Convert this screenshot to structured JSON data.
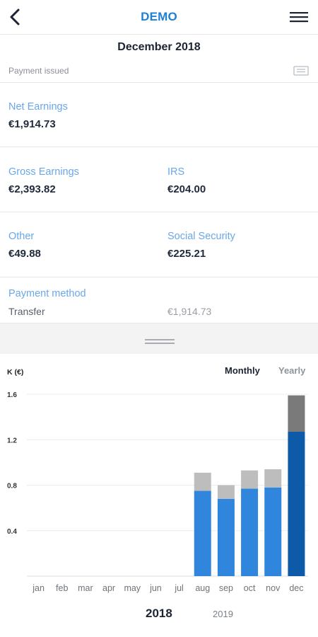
{
  "header": {
    "title": "DEMO"
  },
  "period": {
    "title": "December 2018"
  },
  "status": {
    "text": "Payment issued"
  },
  "net": {
    "label": "Net Earnings",
    "value": "€1,914.73"
  },
  "gross": {
    "label": "Gross Earnings",
    "value": "€2,393.82"
  },
  "irs": {
    "label": "IRS",
    "value": "€204.00"
  },
  "other": {
    "label": "Other",
    "value": "€49.88"
  },
  "social": {
    "label": "Social Security",
    "value": "€225.21"
  },
  "payment": {
    "label": "Payment method",
    "method": "Transfer",
    "amount": "€1,914.73"
  },
  "colors": {
    "accent": "#1d7fd8",
    "label": "#6aa7e8",
    "bar_net": "#2f86dc",
    "bar_net_selected": "#0c5aa8",
    "bar_deduction": "#bdbdbd",
    "bar_deduction_selected": "#7a7a7a"
  },
  "chart_tabs": {
    "monthly": "Monthly",
    "yearly": "Yearly",
    "active": "Monthly"
  },
  "years": {
    "current": "2018",
    "next": "2019"
  },
  "chart_data": {
    "type": "bar",
    "stacked": true,
    "y_unit_label": "K (€)",
    "yticks": [
      0.4,
      0.8,
      1.2,
      1.6
    ],
    "ylim": [
      0,
      1.6
    ],
    "categories": [
      "jan",
      "feb",
      "mar",
      "apr",
      "may",
      "jun",
      "jul",
      "aug",
      "sep",
      "oct",
      "nov",
      "dec"
    ],
    "series": [
      {
        "values": [
          0,
          0,
          0,
          0,
          0,
          0,
          0,
          0.75,
          0.68,
          0.77,
          0.78,
          1.27
        ]
      },
      {
        "values": [
          0,
          0,
          0,
          0,
          0,
          0,
          0,
          0.16,
          0.12,
          0.16,
          0.16,
          0.32
        ]
      }
    ],
    "selected_category": "dec",
    "grid": true
  }
}
